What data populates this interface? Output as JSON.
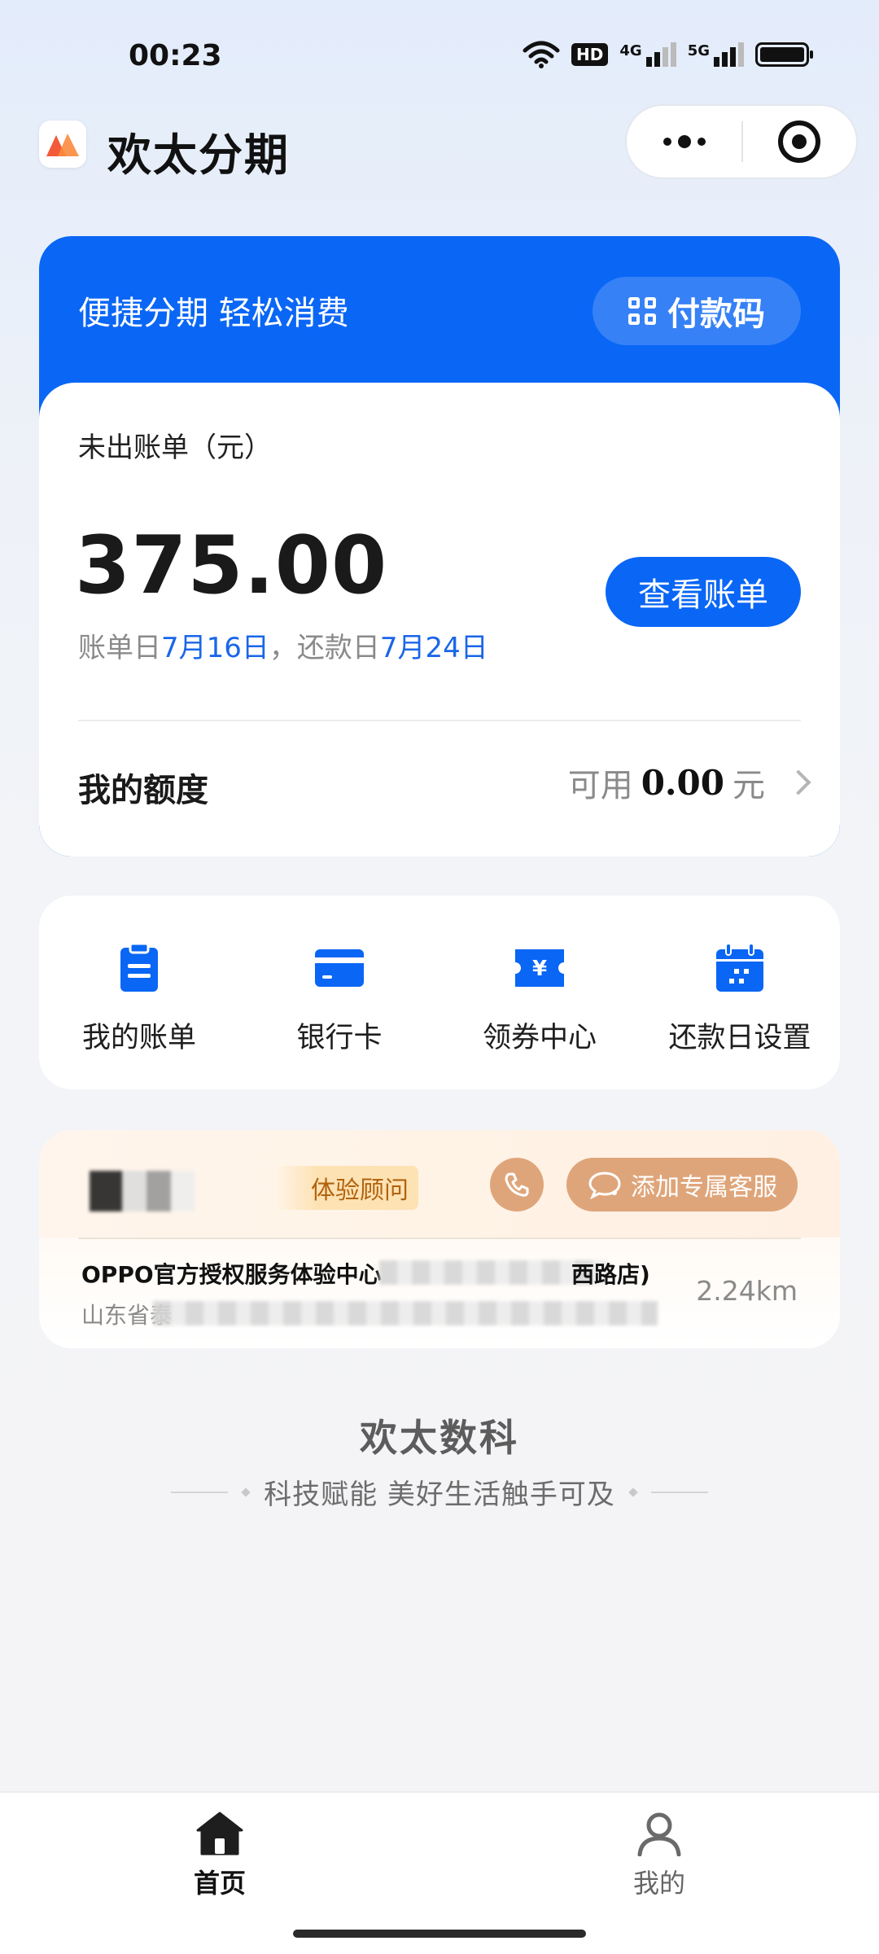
{
  "status_bar": {
    "time": "00:23",
    "hd_badge": "HD",
    "network_1": "4G",
    "network_2": "5G"
  },
  "header": {
    "app_title": "欢太分期",
    "logo_icon": "huantai-logo-icon",
    "more_icon": "more-dots-icon",
    "close_icon": "target-close-icon"
  },
  "bill_card": {
    "slogan": "便捷分期 轻松消费",
    "pay_code_label": "付款码",
    "unbilled_label": "未出账单（元）",
    "amount": "375.00",
    "bill_day_prefix": "账单日",
    "bill_day": "7月16日",
    "repay_day_prefix": "，还款日",
    "repay_day": "7月24日",
    "view_bill_label": "查看账单",
    "limit_label": "我的额度",
    "available_prefix": "可用",
    "available_amount": "0.00",
    "available_unit": "元",
    "accent_color": "#0a66f5"
  },
  "quick_menu": {
    "items": [
      {
        "label": "我的账单",
        "icon": "bill-clipboard-icon"
      },
      {
        "label": "银行卡",
        "icon": "bank-card-icon"
      },
      {
        "label": "领券中心",
        "icon": "coupon-icon"
      },
      {
        "label": "还款日设置",
        "icon": "calendar-icon"
      }
    ]
  },
  "store": {
    "advisor_tag": "体验顾问",
    "add_service_label": "添加专属客服",
    "name": "OPPO官方授权服务体验中心",
    "name_suffix": "西路店)",
    "address": "山东省泰",
    "distance": "2.24km",
    "accent_color": "#dfa57a"
  },
  "footer": {
    "brand": "欢太数科",
    "tagline": "科技赋能 美好生活触手可及"
  },
  "tabbar": {
    "home_label": "首页",
    "mine_label": "我的"
  }
}
